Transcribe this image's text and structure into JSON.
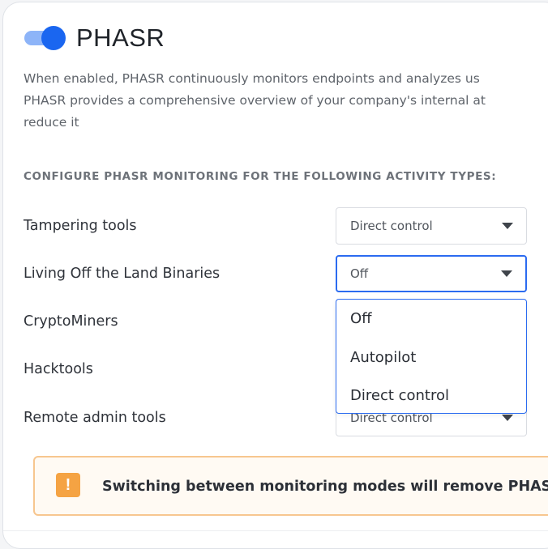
{
  "header": {
    "toggle_state": "on",
    "title": "PHASR"
  },
  "description": {
    "line1": "When enabled, PHASR continuously monitors endpoints and analyzes us",
    "line2": "PHASR provides a comprehensive overview of your company's internal at",
    "line3": "reduce it"
  },
  "section_label": "CONFIGURE PHASR MONITORING FOR THE FOLLOWING ACTIVITY TYPES:",
  "rows": [
    {
      "label": "Tampering tools",
      "value": "Direct control"
    },
    {
      "label": "Living Off the Land Binaries",
      "value": "Off"
    },
    {
      "label": "CryptoMiners",
      "value": ""
    },
    {
      "label": "Hacktools",
      "value": ""
    },
    {
      "label": "Remote admin tools",
      "value": "Direct control"
    }
  ],
  "dropdown": {
    "options": [
      "Off",
      "Autopilot",
      "Direct control"
    ]
  },
  "alert": {
    "icon": "!",
    "text": "Switching between monitoring modes will remove PHASR"
  },
  "colors": {
    "accent": "#1a66f0",
    "warning": "#f5a343"
  }
}
